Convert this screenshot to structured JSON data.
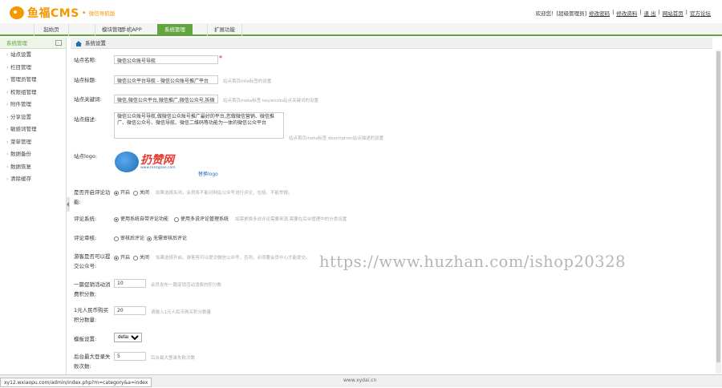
{
  "header": {
    "logo_name": "鱼福CMS",
    "logo_sub": "微信导航版",
    "welcome": "欢迎您！[超级管理员]",
    "links": [
      "修改密码",
      "修改资料",
      "退 出",
      "网站首页",
      "官方论坛"
    ]
  },
  "nav": {
    "tabs": [
      "起始页",
      "模块管理",
      "手机APP",
      "系统管理",
      "扩展功能"
    ],
    "active": "系统管理"
  },
  "sidebar": {
    "title": "系统管理",
    "collapse_glyph": "–",
    "items": [
      "站点设置",
      "栏目管理",
      "管理员管理",
      "权限组管理",
      "附件管理",
      "分享设置",
      "敏感词管理",
      "菜单管理",
      "数据备份",
      "数据恢复",
      "清除缓存"
    ]
  },
  "main": {
    "title": "系统设置",
    "fields": {
      "site_name_label": "站点名称:",
      "site_name_value": "微信公众账号导航",
      "site_title_label": "站点标题:",
      "site_title_value": "微信公众平台导航 - 微信公众账号推广平台",
      "site_title_hint": "站点首页title标签的设置",
      "keywords_label": "站点关键词:",
      "keywords_value": "微信,微信公众平台,微信推广,微信公众号,拆微",
      "keywords_hint": "站点首页meta标签 keywords站点关键词的设置",
      "desc_label": "站点描述:",
      "desc_value": "微信公众账号导航,做微信公众账号推广最好的平台,您做微信营销、微信推广、微信公众号、微信导航、微信二维码等功能为一体的微信公众平台",
      "desc_hint": "站点首页meta标签 description站点描述的设置",
      "logo_label": "站点logo:",
      "logo_text": "扔赞网",
      "logo_url": "www.renzgzan.com",
      "logo_link": "替换logo",
      "comment_label": "是否开启评论功能:",
      "comment_on": "开启",
      "comment_off": "关闭",
      "comment_hint": "如果选择关闭，会员将不能对网站公众号进行评论，包括，不能举报。",
      "comment_system_label": "评论系统:",
      "comment_system_opt1": "使用系统自带评论功能",
      "comment_system_opt2": "使用多说评论管理系统",
      "comment_system_hint": "如需更换多说评论需要来源,需要在后台管理中的分类设置",
      "review_label": "评论审核:",
      "review_opt1": "审核后评论",
      "review_opt2": "无需审核后评论",
      "allow_submit_label": "游客是否可以提交公众号:",
      "allow_submit_on": "开启",
      "allow_submit_off": "关闭",
      "allow_submit_hint": "如果选择开启，游客将可以提交微信公众号，否则，必须要会员中心才能提交。",
      "promo_label": "一篇促销活动消费积分数:",
      "promo_value": "10",
      "promo_hint": "会员发布一篇促销活动消费的积分数",
      "rmb_label": "1元人民币购买积分数量:",
      "rmb_value": "20",
      "rmb_hint": "请输入1元人民币购买积分数量",
      "template_label": "模板设置:",
      "template_value": "default",
      "maxlogin_label": "后台最大登录失败次数:",
      "maxlogin_value": "5",
      "maxlogin_hint": "后台最大登录失败次数"
    }
  },
  "status": {
    "url": "xy12.wxiaopu.com/admin/index.php?m=category&a=index",
    "footer": "www.xydai.cn"
  },
  "watermark": "https://www.huzhan.com/ishop20328",
  "colors": {
    "accent": "#62a53e",
    "brand": "#f39800",
    "link": "#1e6fb7"
  }
}
